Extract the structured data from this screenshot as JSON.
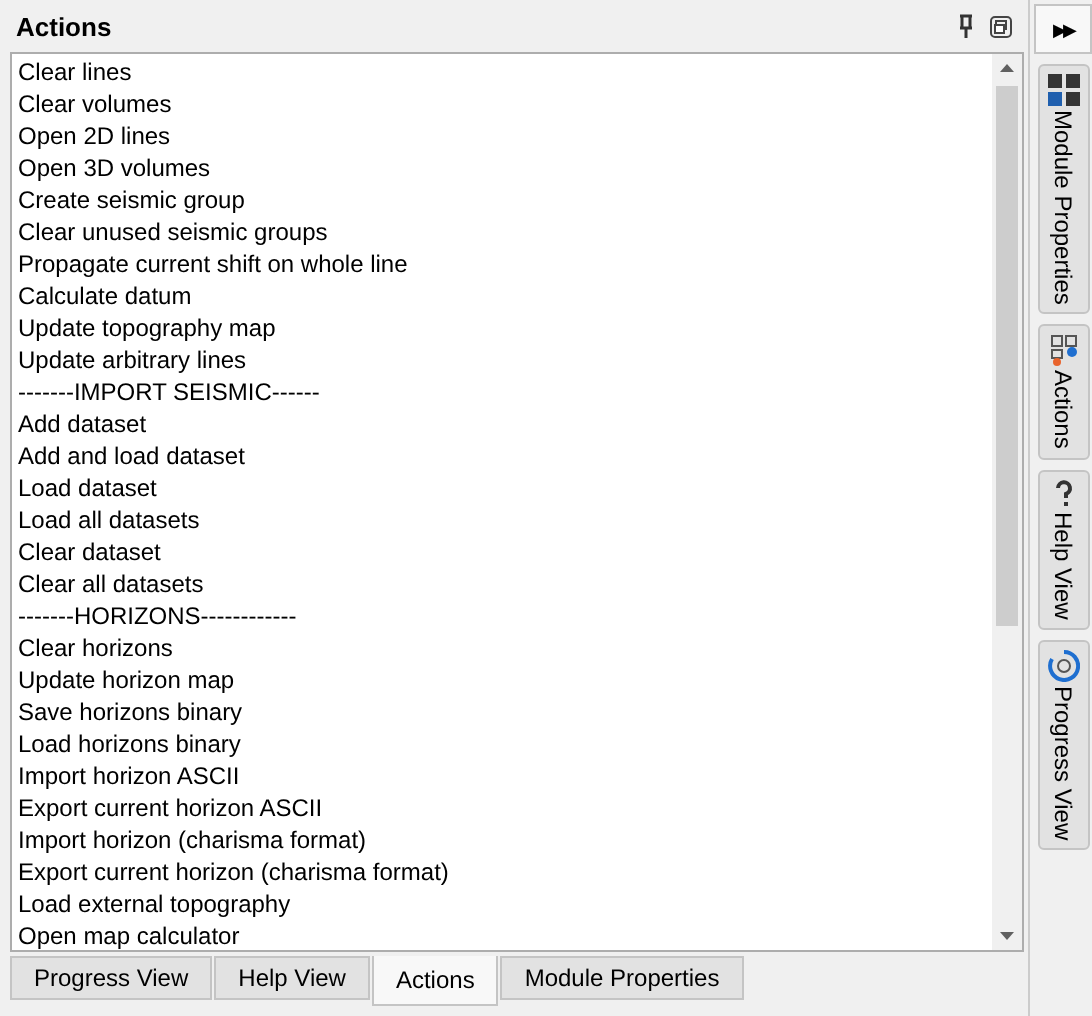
{
  "panel": {
    "title": "Actions"
  },
  "actions": [
    "Clear lines",
    "Clear volumes",
    "Open 2D lines",
    "Open 3D volumes",
    "Create seismic group",
    "Clear unused seismic groups",
    "Propagate current shift on whole line",
    "Calculate datum",
    "Update topography map",
    "Update arbitrary lines",
    "-------IMPORT SEISMIC------",
    "Add dataset",
    "Add and load dataset",
    "Load dataset",
    "Load all datasets",
    "Clear dataset",
    "Clear all datasets",
    "-------HORIZONS------------",
    "Clear horizons",
    "Update horizon map",
    "Save horizons binary",
    "Load horizons binary",
    "Import horizon ASCII",
    "Export current horizon ASCII",
    "Import horizon (charisma format)",
    "Export current horizon (charisma format)",
    "Load external topography",
    "Open map calculator"
  ],
  "bottom_tabs": [
    {
      "label": "Progress View",
      "selected": false
    },
    {
      "label": "Help View",
      "selected": false
    },
    {
      "label": "Actions",
      "selected": true
    },
    {
      "label": "Module Properties",
      "selected": false
    }
  ],
  "expand_button": "▶▶",
  "side_tabs": [
    {
      "kind": "module",
      "label": "Module Properties"
    },
    {
      "kind": "actions",
      "label": "Actions"
    },
    {
      "kind": "help",
      "label": "Help View"
    },
    {
      "kind": "progress",
      "label": "Progress View"
    }
  ]
}
